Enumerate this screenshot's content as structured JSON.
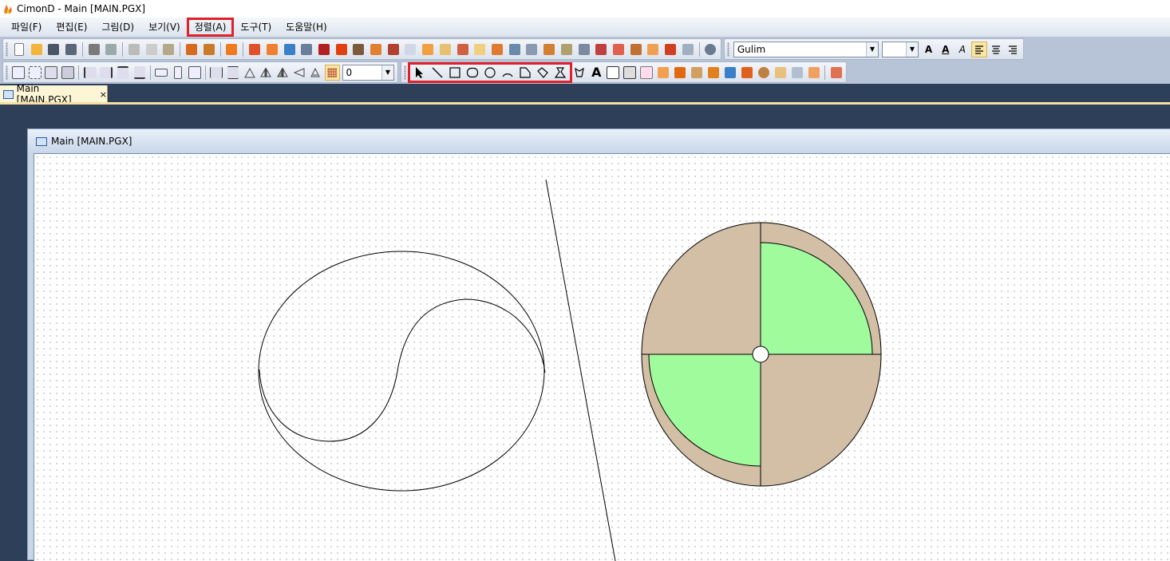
{
  "window": {
    "title": "CimonD - Main [MAIN.PGX]"
  },
  "menu": [
    {
      "label": "파일(F)"
    },
    {
      "label": "편집(E)"
    },
    {
      "label": "그림(D)"
    },
    {
      "label": "보기(V)"
    },
    {
      "label": "정렬(A)"
    },
    {
      "label": "도구(T)"
    },
    {
      "label": "도움말(H)"
    }
  ],
  "toolbar": {
    "font_combo": {
      "value": "Gulim"
    },
    "size_combo": {
      "value": ""
    },
    "text_buttons": {
      "bold_a": "A",
      "underline_a": "A",
      "italic_a": "A",
      "text_tool": "A"
    },
    "grid_combo": {
      "value": "0"
    }
  },
  "tab": {
    "label": "Main [MAIN.PGX]",
    "close": "×"
  },
  "child_window": {
    "title": "Main [MAIN.PGX]"
  },
  "colors": {
    "pie_background": "#d2bfa5",
    "quadrant_fill": "#9ffb9c",
    "highlight": "#e0202a"
  }
}
